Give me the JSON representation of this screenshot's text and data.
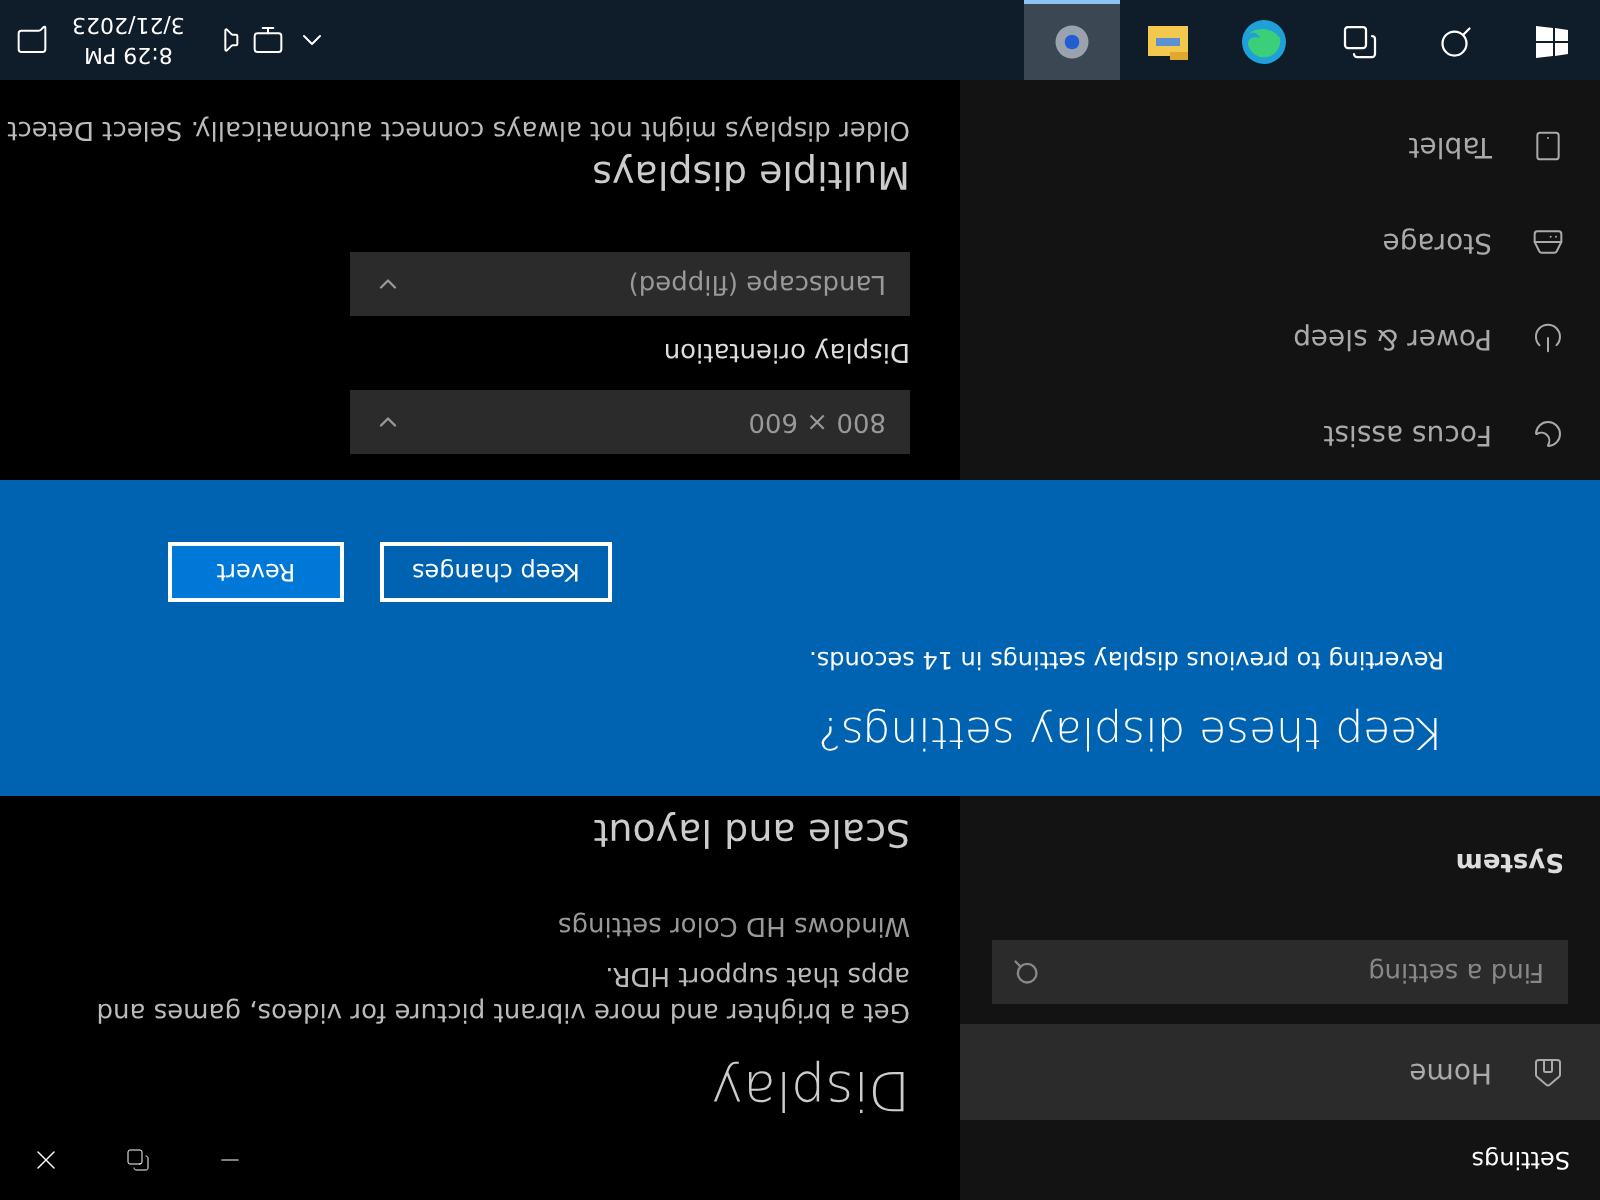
{
  "window": {
    "title": "Settings"
  },
  "sidebar": {
    "home": "Home",
    "search": {
      "placeholder": "Find a setting"
    },
    "section": "System",
    "items": [
      {
        "kind": "focus",
        "label": "Focus assist"
      },
      {
        "kind": "power",
        "label": "Power & sleep"
      },
      {
        "kind": "storage",
        "label": "Storage"
      },
      {
        "kind": "tablet",
        "label": "Tablet"
      }
    ]
  },
  "content": {
    "title": "Display",
    "description": "Get a brighter and more vibrant picture for videos, games and apps that support HDR.",
    "link": "Windows HD Color settings",
    "scale_heading": "Scale and layout",
    "resolution": "800 × 600",
    "orientation_label": "Display orientation",
    "orientation": "Landscape (flipped)",
    "multiple_heading": "Multiple displays",
    "multiple_text": "Older displays might not always connect automatically. Select Detect"
  },
  "dialog": {
    "title": "Keep these display settings?",
    "message": "Reverting to previous display settings in 14 seconds.",
    "buttons": [
      {
        "label": "Keep changes",
        "selected": false
      },
      {
        "label": "Revert",
        "selected": true
      }
    ]
  },
  "taskbar": {
    "apps": [
      {
        "kind": "search",
        "selected": false
      },
      {
        "kind": "taskview",
        "selected": false
      },
      {
        "kind": "edge",
        "selected": false
      },
      {
        "kind": "explorer",
        "selected": false
      },
      {
        "kind": "settings",
        "selected": true
      }
    ],
    "time": "8:29 PM",
    "date": "3/21/2023"
  }
}
